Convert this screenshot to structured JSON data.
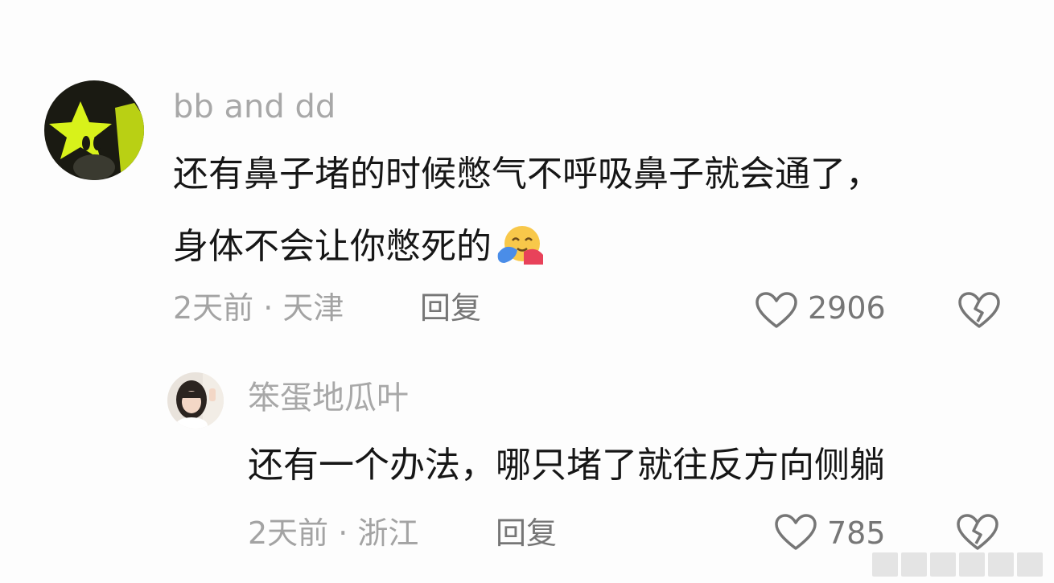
{
  "comments": [
    {
      "username": "bb and dd",
      "text_line1": "还有鼻子堵的时候憋气不呼吸鼻子就会通了，",
      "text_line2": "身体不会让你憋死的",
      "emoji": "hugging-face-emoji",
      "meta": "2天前 · 天津",
      "reply_label": "回复",
      "like_count": "2906"
    },
    {
      "username": "笨蛋地瓜叶",
      "text_line1": "还有一个办法，哪只堵了就往反方向侧躺",
      "meta": "2天前 · 浙江",
      "reply_label": "回复",
      "like_count": "785"
    }
  ],
  "colors": {
    "username": "#a8a8a8",
    "text": "#161616",
    "meta": "#a3a3a3",
    "action": "#767676",
    "avatar_star": "#d8f21a"
  }
}
